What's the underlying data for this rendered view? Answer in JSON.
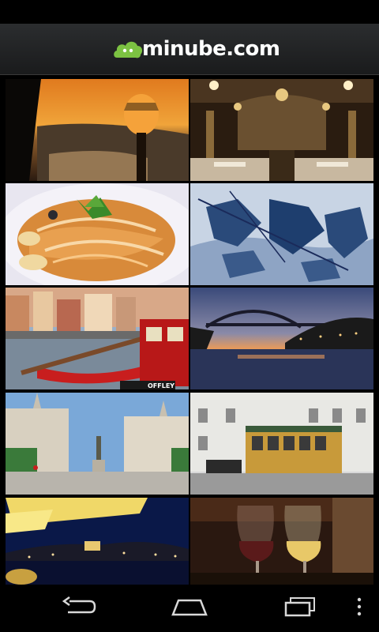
{
  "app": {
    "logo_text": "minube.com",
    "brand_color": "#7cc242"
  },
  "gallery": {
    "photos": [
      {
        "subject": "sunset over river with street lamp"
      },
      {
        "subject": "ornate cafe interior with chandeliers"
      },
      {
        "subject": "plate of pasta with herbs"
      },
      {
        "subject": "blue tile mural of battle scene"
      },
      {
        "subject": "riverside houses with red rabelo boat"
      },
      {
        "subject": "arched bridge over river at dusk"
      },
      {
        "subject": "city square with monument"
      },
      {
        "subject": "yellow vintage tram on street"
      },
      {
        "subject": "night view of city across river"
      },
      {
        "subject": "two glasses of port wine"
      }
    ],
    "boat_sign": "OFFLEY"
  },
  "navbar": {
    "back_icon": "back-icon",
    "home_icon": "home-icon",
    "recents_icon": "recent-apps-icon",
    "menu_icon": "overflow-menu-icon"
  }
}
